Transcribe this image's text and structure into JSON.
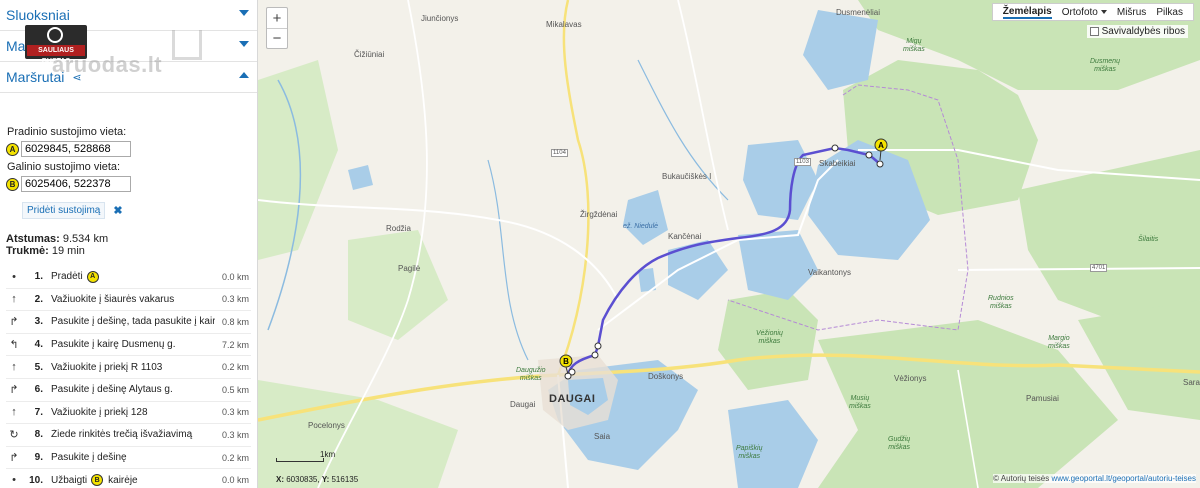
{
  "sidebar": {
    "panels": [
      {
        "title": "Sluoksniai"
      },
      {
        "title": "Ma"
      },
      {
        "title": "Maršrutai"
      }
    ],
    "watermark": {
      "logo_text": "SAULIAUS BUSTAS",
      "site": "aruodas.lt"
    },
    "route": {
      "start_label": "Pradinio sustojimo vieta:",
      "start_value": "6029845, 528868",
      "end_label": "Galinio sustojimo vieta:",
      "end_value": "6025406, 522378",
      "add_stop": "Pridėti sustojimą",
      "distance_label": "Atstumas:",
      "distance_value": "9.534 km",
      "duration_label": "Trukmė:",
      "duration_value": "19 min"
    },
    "steps": [
      {
        "num": "1.",
        "icon": "dot-icon",
        "glyph": "•",
        "text": "Pradėti",
        "pin": "A",
        "dist": "0.0 km"
      },
      {
        "num": "2.",
        "icon": "arrow-up-icon",
        "glyph": "↑",
        "text": "Važiuokite į šiaurės vakarus",
        "dist": "0.3 km"
      },
      {
        "num": "3.",
        "icon": "turn-right-icon",
        "glyph": "↱",
        "text": "Pasukite į dešinę, tada pasukite į kairę",
        "dist": "0.8 km"
      },
      {
        "num": "4.",
        "icon": "turn-left-icon",
        "glyph": "↰",
        "text": "Pasukite į kairę Dusmenų g.",
        "dist": "7.2 km"
      },
      {
        "num": "5.",
        "icon": "arrow-up-icon",
        "glyph": "↑",
        "text": "Važiuokite į priekį R 1103",
        "dist": "0.2 km"
      },
      {
        "num": "6.",
        "icon": "turn-right-icon",
        "glyph": "↱",
        "text": "Pasukite į dešinę Alytaus g.",
        "dist": "0.5 km"
      },
      {
        "num": "7.",
        "icon": "arrow-up-icon",
        "glyph": "↑",
        "text": "Važiuokite į priekį 128",
        "dist": "0.3 km"
      },
      {
        "num": "8.",
        "icon": "roundabout-icon",
        "glyph": "↻",
        "text": "Žiede rinkitės trečią išvažiavimą",
        "dist": "0.3 km"
      },
      {
        "num": "9.",
        "icon": "turn-right-icon",
        "glyph": "↱",
        "text": "Pasukite į dešinę",
        "dist": "0.2 km"
      },
      {
        "num": "10.",
        "icon": "finish-icon",
        "glyph": "•",
        "text": "Užbaigti",
        "pin": "B",
        "text_after": "kairėje",
        "dist": "0.0 km"
      }
    ]
  },
  "map": {
    "zoom_in": "+",
    "zoom_out": "−",
    "layers": [
      "Žemėlapis",
      "Ortofoto",
      "Mišrus",
      "Pilkas"
    ],
    "active_layer": "Žemėlapis",
    "municipality_label": "Savivaldybės ribos",
    "scale_label": "1km",
    "coords_x_label": "X:",
    "coords_x": "6030835",
    "coords_y_label": "Y:",
    "coords_y": "516135",
    "copyright": "© Autorių teisės",
    "copyright_link": "www.geoportal.lt/geoportal/autoriu-teises",
    "pin_a": "A",
    "pin_b": "B",
    "places": {
      "junciionys": "Jiunčionys",
      "mikalavas": "Mikalavas",
      "dusmeneliai": "Dusmenėliai",
      "cizuniai": "Čižiūniai",
      "skabeikiai": "Skabeikiai",
      "bukauciskes": "Bukaučiškės I",
      "zirgzdenai": "Žirgždėnai",
      "kanceнai": "Kančėnai",
      "rodzia": "Rodžia",
      "pagile": "Pagilė",
      "vaikantonys": "Vaikantonys",
      "daugai": "DAUGAI",
      "daugai_small": "Daugai",
      "doskonys": "Doškonys",
      "veziony": "Vėžionys",
      "pocelonys": "Pocelonys",
      "saia": "Saia",
      "pamusiai": "Pamusiai",
      "sara": "Sara",
      "niedule": "ež. Niedulė",
      "silaitis": "Šilaitis"
    },
    "forests": {
      "dusmenu": "Dusmenų\nmiškas",
      "migu": "Migų\nmiškas",
      "rudnios": "Rudnios\nmiškas",
      "veziony_forest": "Vėžionių\nmiškas",
      "margio": "Margio\nmiškas",
      "musiu": "Musių\nmiškas",
      "dauguz": "Daugužio\nmiškas",
      "gudziu": "Gudžių\nmiškas",
      "papiskiu": "Papiškių\nmiškas"
    },
    "road_labels": {
      "r1104": "1104",
      "r1103": "1103",
      "r4701": "4701"
    },
    "colors": {
      "water": "#a9cde8",
      "forest": "#c9e4b6",
      "land": "#f3f1ea",
      "route": "#5b4fd1",
      "road_main": "#f7e27a",
      "road_minor": "#ffffff",
      "accent": "#1a6fb5"
    }
  }
}
